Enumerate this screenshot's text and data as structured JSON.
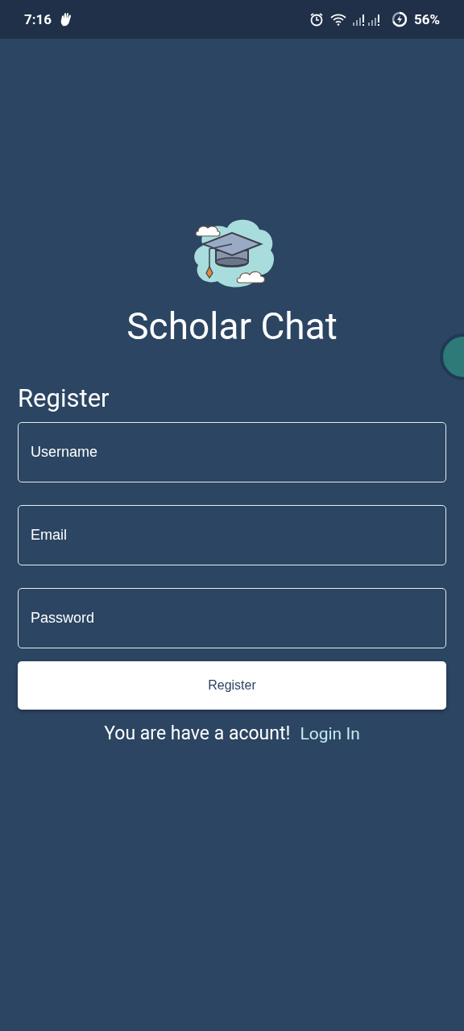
{
  "status_bar": {
    "time": "7:16",
    "battery": "56%"
  },
  "app": {
    "title": "Scholar Chat"
  },
  "form": {
    "heading": "Register",
    "fields": [
      {
        "placeholder": "Username"
      },
      {
        "placeholder": "Email"
      },
      {
        "placeholder": "Password"
      }
    ],
    "submit": "Register"
  },
  "footer": {
    "prompt": "You are have a acount!",
    "link": "Login In"
  }
}
